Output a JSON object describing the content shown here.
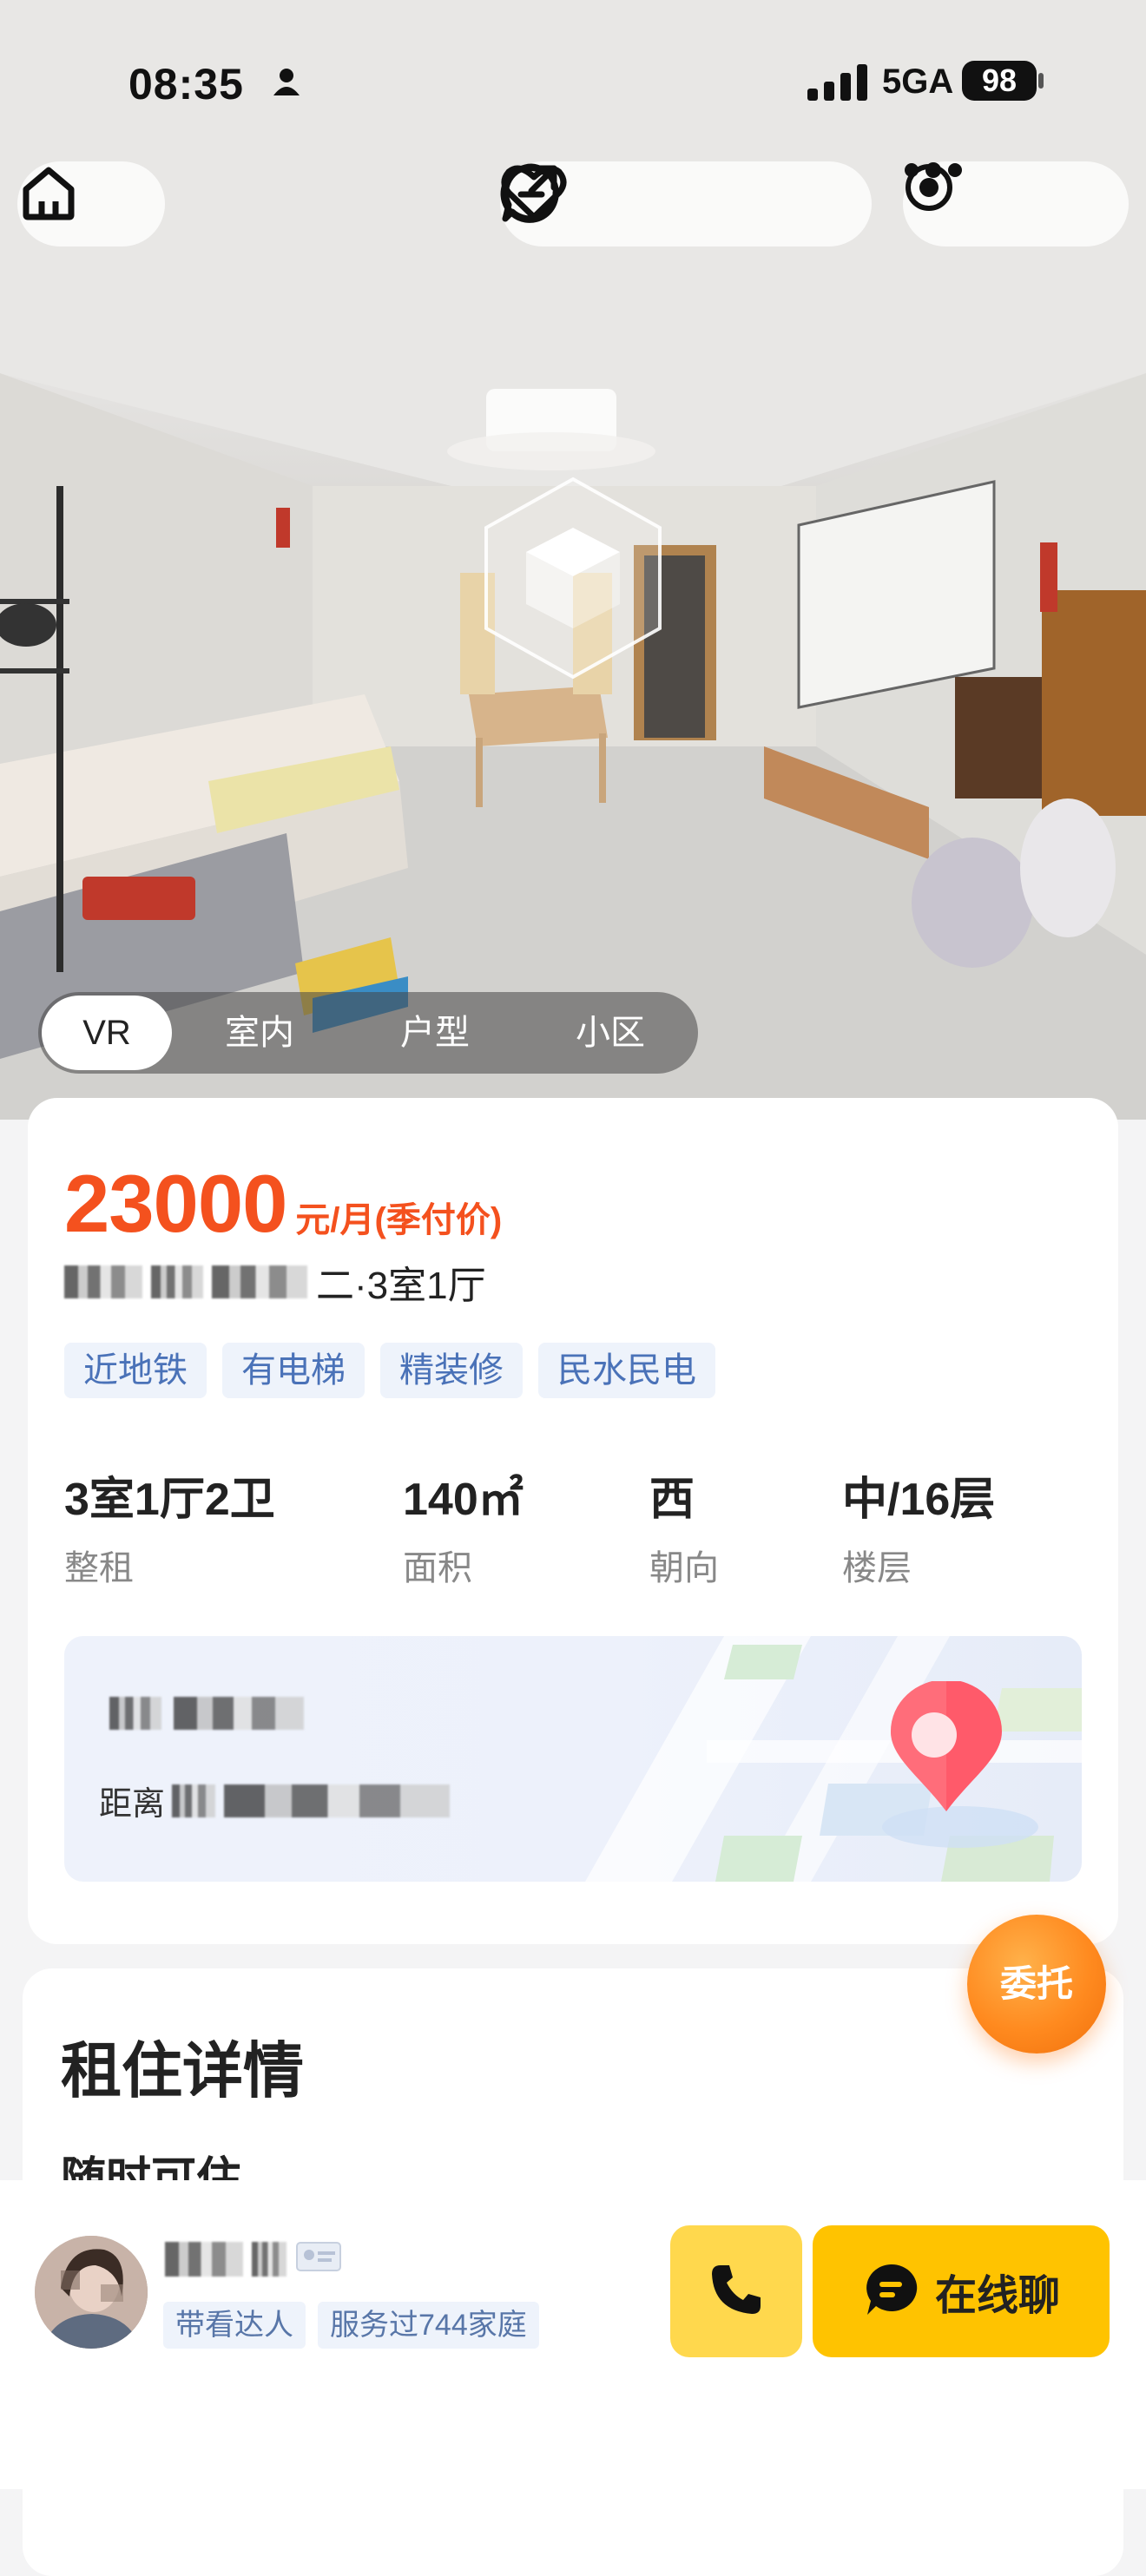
{
  "status_bar": {
    "time": "08:35",
    "network": "5GA",
    "battery": "98"
  },
  "media_tabs": [
    {
      "label": "VR"
    },
    {
      "label": "室内"
    },
    {
      "label": "户型"
    },
    {
      "label": "小区"
    }
  ],
  "listing": {
    "price": "23000",
    "price_unit": "元/月(季付价)",
    "title_suffix": "二·3室1厅",
    "tags": [
      "近地铁",
      "有电梯",
      "精装修",
      "民水民电"
    ],
    "stats": [
      {
        "value": "3室1厅2卫",
        "label": "整租"
      },
      {
        "value": "140㎡",
        "label": "面积"
      },
      {
        "value": "西",
        "label": "朝向"
      },
      {
        "value": "中/16层",
        "label": "楼层"
      }
    ],
    "map_distance_prefix": "距离"
  },
  "delegate_button": "委托",
  "rental_details": {
    "title": "租住详情",
    "availability": "随时可住"
  },
  "agent": {
    "tags": [
      "带看达人",
      "服务过744家庭"
    ]
  },
  "actions": {
    "chat_label": "在线聊"
  },
  "colors": {
    "price": "#f4511e",
    "accent_yellow": "#ffc300",
    "call_yellow": "#ffd84d",
    "tag_bg": "#eef3fb",
    "tag_text": "#4a72b8",
    "delegate_orange": "#ff8a1f"
  },
  "icons": [
    "home-icon",
    "heart-icon",
    "share-icon",
    "message-icon",
    "more-icon",
    "target-icon",
    "vr-cube-icon",
    "map-pin-icon",
    "phone-icon",
    "chat-bubble-icon",
    "person-icon",
    "signal-icon",
    "id-card-icon"
  ]
}
